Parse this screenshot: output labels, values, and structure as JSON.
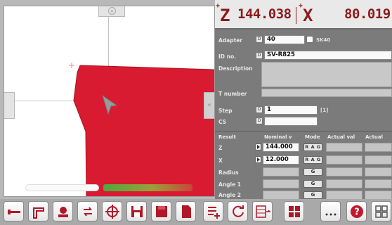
{
  "readout": {
    "z_axis": "Z",
    "z_value": "144.038",
    "x_axis": "X",
    "x_value": "80.019"
  },
  "panel": {
    "adapter_label": "Adapter",
    "adapter_value": "40",
    "adapter_tag": "SK40",
    "id_label": "ID no.",
    "id_value": "SV-R825",
    "description_label": "Description",
    "t_number_label": "T number",
    "step_label": "Step",
    "step_value": "1",
    "step_count": "[1]",
    "cs_label": "CS"
  },
  "results": {
    "headers": [
      "Result",
      "Nominal v",
      "Mode",
      "Actual val",
      "Actual"
    ],
    "rows": [
      {
        "label": "Z",
        "nominal": "144.000",
        "mode": "R A G"
      },
      {
        "label": "X",
        "nominal": "12.000",
        "mode": "R A G"
      },
      {
        "label": "Radius",
        "nominal": "",
        "mode": "G"
      },
      {
        "label": "Angle 1",
        "nominal": "",
        "mode": "G"
      },
      {
        "label": "Angle 2",
        "nominal": "",
        "mode": "G"
      }
    ]
  },
  "progress": {
    "value": 0.65
  },
  "colors": {
    "workpiece": "#d81b30",
    "readout_text": "#8c1b1b",
    "panel_bg": "#7b7b7b",
    "help_button": "#c0182e"
  },
  "toolbar": {
    "icons": [
      "tool-icon",
      "tool-holder-icon",
      "measure-icon",
      "swap-icon",
      "crosshair-icon",
      "save-disk-icon",
      "save-red-icon",
      "document-icon",
      "list-add-icon",
      "refresh-icon",
      "table-export-icon",
      "grid-icon",
      "more-icon",
      "help-icon",
      "apps-icon"
    ],
    "more_label": "...",
    "help_label": "?"
  }
}
